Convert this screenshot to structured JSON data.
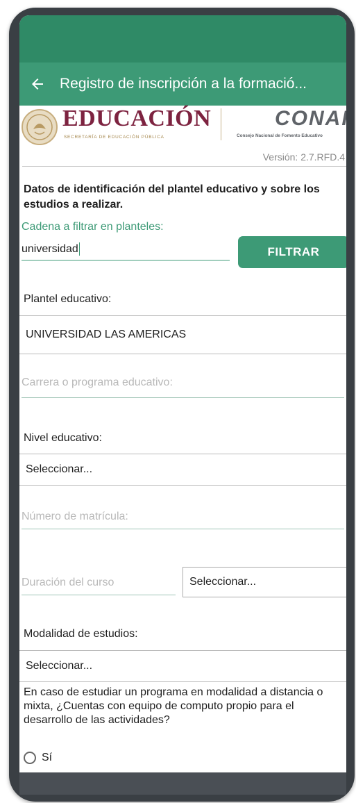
{
  "appbar": {
    "title": "Registro de inscripción a la formació..."
  },
  "header": {
    "education_logo": "EDUCACIÓN",
    "education_sub": "SECRETARÍA DE EDUCACIÓN PÚBLICA",
    "conafe_logo": "CONAFE",
    "conafe_sub": "Consejo Nacional de Fomento Educativo",
    "version": "Versión: 2.7.RFD.4"
  },
  "form": {
    "section_title": "Datos de identificación del plantel educativo y sobre los estudios a realizar.",
    "filter_label": "Cadena a filtrar en planteles:",
    "filter_value": "universidad",
    "filter_button": "FILTRAR",
    "plantel_label": "Plantel educativo:",
    "plantel_value": "UNIVERSIDAD LAS AMERICAS",
    "carrera_placeholder": "Carrera o programa educativo:",
    "nivel_label": "Nivel educativo:",
    "nivel_value": "Seleccionar...",
    "matricula_placeholder": "Número de matrícula:",
    "duracion_placeholder": "Duración del curso",
    "duracion_value": "Seleccionar...",
    "modalidad_label": "Modalidad de estudios:",
    "modalidad_value": "Seleccionar...",
    "question": "En caso de estudiar un programa en modalidad a distancia o mixta, ¿Cuentas con equipo de computo propio para el desarrollo de las actividades?",
    "radio_si": "Sí"
  },
  "colors": {
    "primary": "#3d9a76",
    "status": "#2f8a66",
    "brand": "#7d2340"
  }
}
